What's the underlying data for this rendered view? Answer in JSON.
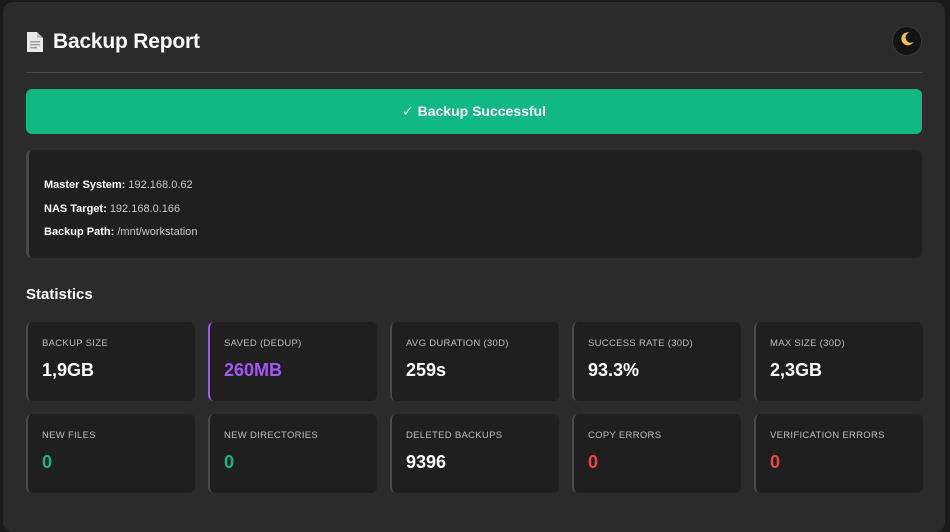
{
  "header": {
    "title": "Backup Report",
    "title_icon": "document-icon",
    "theme_toggle_icon": "moon-icon"
  },
  "status": {
    "label": "✓ Backup Successful",
    "color": "#10b981"
  },
  "info": {
    "items": [
      {
        "key": "Master System:",
        "value": "192.168.0.62"
      },
      {
        "key": "NAS Target:",
        "value": "192.168.0.166"
      },
      {
        "key": "Backup Path:",
        "value": "/mnt/workstation"
      }
    ]
  },
  "statistics": {
    "title": "Statistics",
    "cards": [
      {
        "label": "BACKUP SIZE",
        "value": "1,9GB",
        "color": "#ffffff"
      },
      {
        "label": "SAVED (DEDUP)",
        "value": "260MB",
        "color": "#a855f7"
      },
      {
        "label": "AVG DURATION (30D)",
        "value": "259s",
        "color": "#ffffff"
      },
      {
        "label": "SUCCESS RATE (30D)",
        "value": "93.3%",
        "color": "#ffffff"
      },
      {
        "label": "MAX SIZE (30D)",
        "value": "2,3GB",
        "color": "#ffffff"
      },
      {
        "label": "NEW FILES",
        "value": "0",
        "color": "#10b981"
      },
      {
        "label": "NEW DIRECTORIES",
        "value": "0",
        "color": "#10b981"
      },
      {
        "label": "DELETED BACKUPS",
        "value": "9396",
        "color": "#ffffff"
      },
      {
        "label": "COPY ERRORS",
        "value": "0",
        "color": "#ef4444"
      },
      {
        "label": "VERIFICATION ERRORS",
        "value": "0",
        "color": "#ef4444"
      }
    ]
  }
}
